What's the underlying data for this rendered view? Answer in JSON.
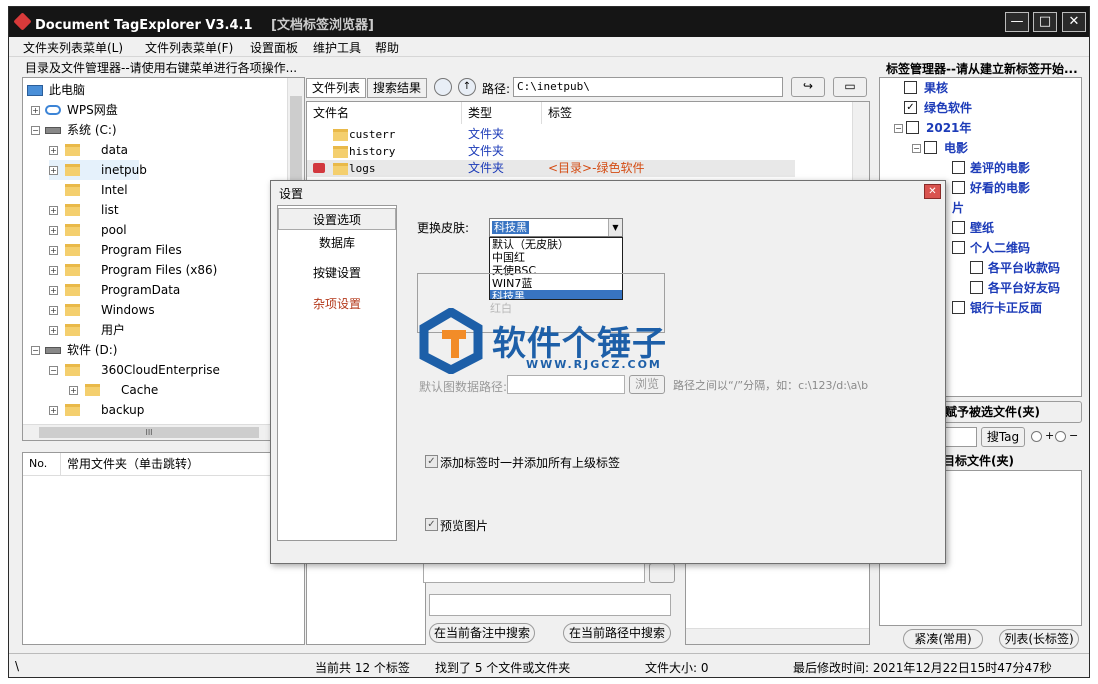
{
  "app": {
    "title": "Document TagExplorer  V3.4.1",
    "subtitle": "[文档标签浏览器]"
  },
  "window_buttons": {
    "minimize": "—",
    "maximize": "□",
    "close": "✕"
  },
  "menu": [
    "文件夹列表菜单(L)",
    "文件列表菜单(F)",
    "设置面板",
    "维护工具",
    "帮助"
  ],
  "left": {
    "header": "目录及文件管理器--请使用右键菜单进行各项操作...",
    "tree": [
      {
        "label": "此电脑"
      },
      {
        "label": "WPS网盘"
      },
      {
        "label": "系统 (C:)"
      },
      {
        "label": "data"
      },
      {
        "label": "inetpub"
      },
      {
        "label": "Intel"
      },
      {
        "label": "list"
      },
      {
        "label": "pool"
      },
      {
        "label": "Program Files"
      },
      {
        "label": "Program Files (x86)"
      },
      {
        "label": "ProgramData"
      },
      {
        "label": "Windows"
      },
      {
        "label": "用户"
      },
      {
        "label": "软件 (D:)"
      },
      {
        "label": "360CloudEnterprise"
      },
      {
        "label": "Cache"
      },
      {
        "label": "backup"
      }
    ],
    "hscroll_label": "III",
    "fav_headers": [
      "No.",
      "常用文件夹（单击跳转）"
    ]
  },
  "middle": {
    "tabs": [
      "文件列表",
      "搜索结果"
    ],
    "path_label": "路径:",
    "path_value": "C:\\inetpub\\",
    "columns": [
      "文件名",
      "类型",
      "标签"
    ],
    "rows": [
      {
        "name": "custerr",
        "type": "文件夹",
        "tag": ""
      },
      {
        "name": "history",
        "type": "文件夹",
        "tag": ""
      },
      {
        "name": "logs",
        "type": "文件夹",
        "tag": "<目录>-绿色软件"
      }
    ],
    "search_notes_button": "在当前备注中搜索",
    "search_path_button": "在当前路径中搜索"
  },
  "right": {
    "header": "标签管理器--请从建立新标签开始...",
    "tags": [
      {
        "label": "果核",
        "checked": false
      },
      {
        "label": "绿色软件",
        "checked": true
      },
      {
        "label": "2021年",
        "checked": false
      },
      {
        "label": "电影",
        "checked": false
      },
      {
        "label": "差评的电影",
        "checked": false
      },
      {
        "label": "好看的电影",
        "checked": false
      },
      {
        "label": "片",
        "checked": false
      },
      {
        "label": "壁纸",
        "checked": false
      },
      {
        "label": "个人二维码",
        "checked": false
      },
      {
        "label": "各平台收款码",
        "checked": false
      },
      {
        "label": "各平台好友码",
        "checked": false
      },
      {
        "label": "银行卡正反面",
        "checked": false
      }
    ],
    "assign_button": "标签赋予被选文件(夹)",
    "search_tag_button": "搜Tag",
    "radio_plus": "+",
    "radio_minus": "−",
    "dblclick_hint": "双击添加给目标文件(夹)",
    "compact_button": "紧凑(常用)",
    "list_button": "列表(长标签)"
  },
  "status": {
    "path": "\\",
    "tags_count": "当前共 12 个标签",
    "found": "找到了 5 个文件或文件夹",
    "size": "文件大小: 0",
    "modified": "最后修改时间: 2021年12月22日15时47分47秒"
  },
  "dialog": {
    "title": "设置",
    "nav": [
      "设置选项",
      "数据库",
      "按键设置",
      "杂项设置"
    ],
    "skin_label": "更换皮肤:",
    "skin_selected": "科技黑",
    "skin_options": [
      "默认（无皮肤）",
      "中国红",
      "天使BSC",
      "WIN7蓝",
      "科技黑"
    ],
    "hidden_option": "红白",
    "default_path_label": "默认图数据路径:",
    "browse_button": "浏览",
    "path_hint": "路径之间以“/”分隔，如：c:\\123/d:\\a\\b",
    "add_parent_tags": "添加标签时一并添加所有上级标签",
    "add_parent_tags_checked": true,
    "preview_images": "预览图片",
    "preview_images_checked": true
  },
  "watermark": {
    "text": "软件个锤子",
    "url": "WWW.RJGCZ.COM"
  }
}
